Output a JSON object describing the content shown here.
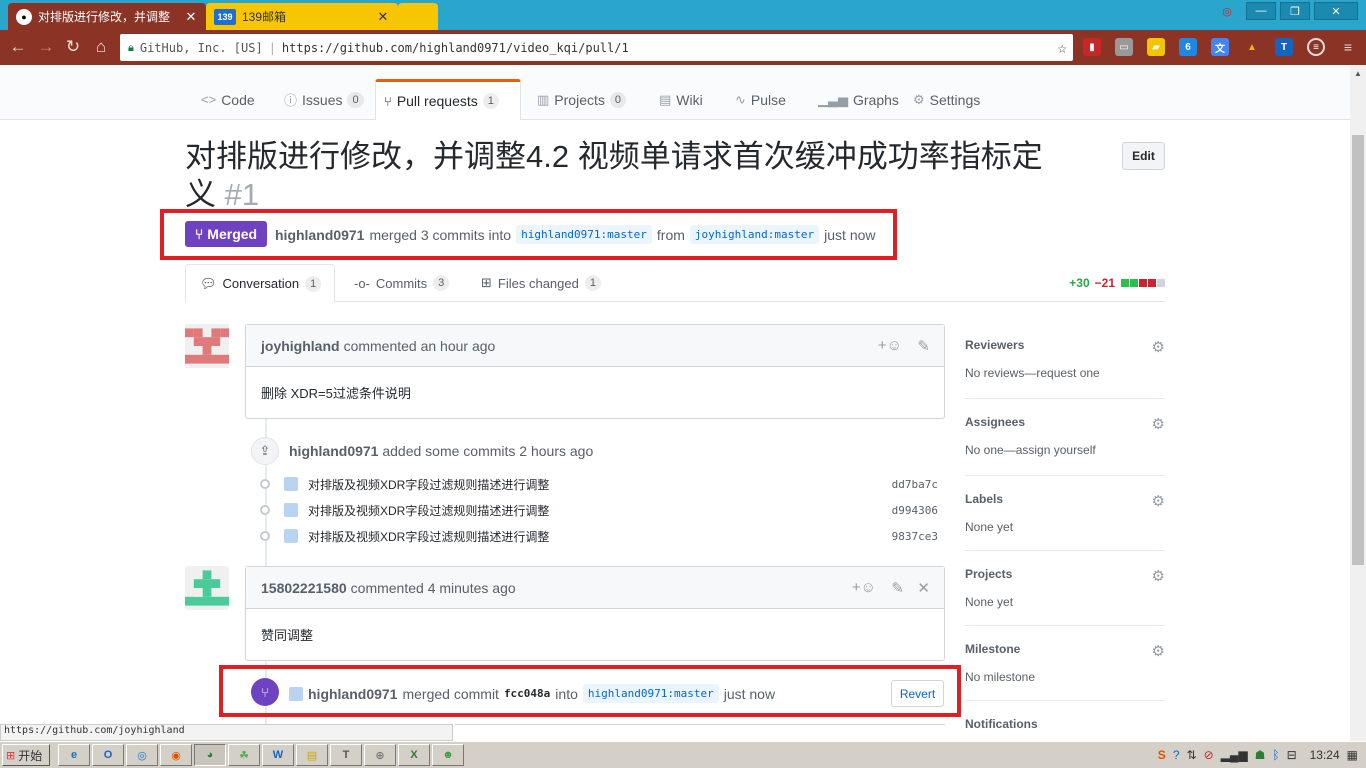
{
  "browser": {
    "tabs": [
      {
        "title": "对排版进行修改，并调整",
        "close": "✕"
      },
      {
        "title": "139邮箱",
        "close": "✕"
      }
    ],
    "address": {
      "site": "GitHub, Inc. [US]",
      "url": "https://github.com/highland0971/video_kqi/pull/1"
    },
    "status_url": "https://github.com/joyhighland"
  },
  "repo_nav": {
    "tabs": [
      {
        "label": "Code",
        "icon": "code-icon"
      },
      {
        "label": "Issues",
        "count": "0",
        "icon": "issue-icon"
      },
      {
        "label": "Pull requests",
        "count": "1",
        "icon": "pull-request-icon"
      },
      {
        "label": "Projects",
        "count": "0",
        "icon": "project-icon"
      },
      {
        "label": "Wiki",
        "icon": "book-icon"
      },
      {
        "label": "Pulse",
        "icon": "pulse-icon"
      },
      {
        "label": "Graphs",
        "icon": "graph-icon"
      },
      {
        "label": "Settings",
        "icon": "gear-icon"
      }
    ]
  },
  "pr": {
    "title": "对排版进行修改，并调整4.2 视频单请求首次缓冲成功率指标定义",
    "number": "#1",
    "edit_label": "Edit",
    "state": "Merged",
    "meta": {
      "author": "highland0971",
      "merged_text": "merged 3 commits into",
      "base_branch": "highland0971:master",
      "from_text": "from",
      "head_branch": "joyhighland:master",
      "time": "just now"
    },
    "tabs": [
      {
        "label": "Conversation",
        "count": "1"
      },
      {
        "label": "Commits",
        "count": "3"
      },
      {
        "label": "Files changed",
        "count": "1"
      }
    ],
    "diffstat": {
      "additions": "+30",
      "deletions": "−21"
    }
  },
  "timeline": {
    "comment1": {
      "author": "joyhighland",
      "action": "commented an hour ago",
      "body": "删除 XDR=5过滤条件说明"
    },
    "commits_event": {
      "author": "highland0971",
      "action": "added some commits 2 hours ago"
    },
    "commits": [
      {
        "message": "对排版及视频XDR字段过滤规则描述进行调整",
        "sha": "dd7ba7c"
      },
      {
        "message": "对排版及视频XDR字段过滤规则描述进行调整",
        "sha": "d994306"
      },
      {
        "message": "对排版及视频XDR字段过滤规则描述进行调整",
        "sha": "9837ce3"
      }
    ],
    "comment2": {
      "author": "15802221580",
      "action": "commented 4 minutes ago",
      "body": "赞同调整"
    },
    "merge_event": {
      "author": "highland0971",
      "action": "merged commit",
      "sha": "fcc048a",
      "into": "into",
      "branch": "highland0971:master",
      "time": "just now",
      "revert_label": "Revert"
    }
  },
  "sidebar": [
    {
      "heading": "Reviewers",
      "value": "No reviews—request one"
    },
    {
      "heading": "Assignees",
      "value": "No one—assign yourself"
    },
    {
      "heading": "Labels",
      "value": "None yet"
    },
    {
      "heading": "Projects",
      "value": "None yet"
    },
    {
      "heading": "Milestone",
      "value": "No milestone"
    },
    {
      "heading": "Notifications",
      "value": ""
    }
  ],
  "taskbar": {
    "start_label": "开始",
    "clock": "13:24"
  },
  "colors": {
    "merged": "#6f42c1",
    "accent_tab": "#e36209",
    "highlight_box": "#e01e24",
    "link": "#0366d6"
  }
}
